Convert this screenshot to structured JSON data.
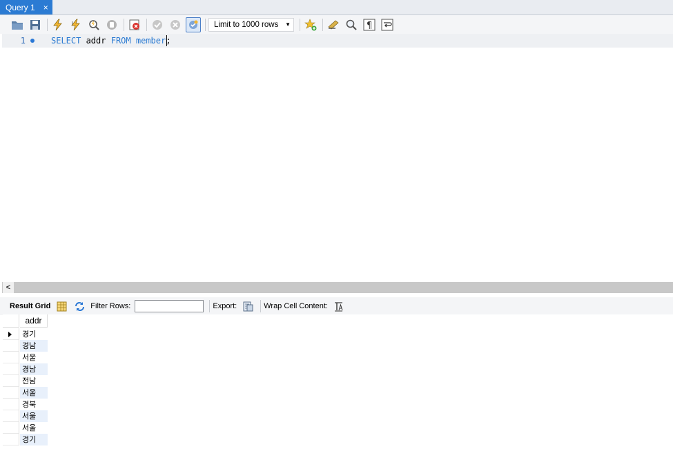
{
  "tab": {
    "title": "Query 1",
    "close_glyph": "×"
  },
  "toolbar": {
    "icons": [
      "folder-icon",
      "save-icon",
      "execute-icon",
      "execute-current-icon",
      "explain-icon",
      "stop-icon",
      "toggle-error-icon",
      "commit-icon",
      "rollback-icon",
      "autocommit-icon",
      "bookmark-add-icon",
      "beautify-icon",
      "find-icon",
      "invisible-chars-icon",
      "wrap-icon"
    ],
    "limit_select": {
      "value": "Limit to 1000 rows"
    }
  },
  "editor": {
    "line_number": "1",
    "code": {
      "kw1": "SELECT",
      "t1": " addr ",
      "kw2": "FROM",
      "t2": " ",
      "kw3": "member",
      "t3": ";"
    }
  },
  "scrollbar": {
    "left_glyph": "<"
  },
  "result_toolbar": {
    "result_grid_label": "Result Grid",
    "filter_label": "Filter Rows:",
    "filter_value": "",
    "export_label": "Export:",
    "wrap_label": "Wrap Cell Content:"
  },
  "grid": {
    "columns": [
      "addr"
    ],
    "rows": [
      "경기",
      "경남",
      "서울",
      "경남",
      "전남",
      "서울",
      "경북",
      "서울",
      "서울",
      "경기"
    ]
  }
}
